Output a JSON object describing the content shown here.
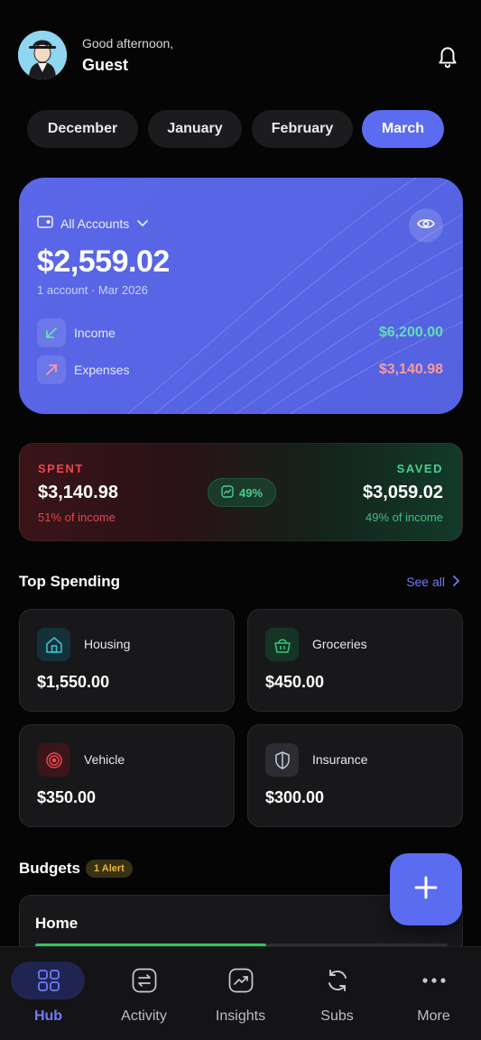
{
  "header": {
    "greeting": "Good afternoon,",
    "name": "Guest"
  },
  "months": [
    {
      "label": "December",
      "active": false
    },
    {
      "label": "January",
      "active": false
    },
    {
      "label": "February",
      "active": false
    },
    {
      "label": "March",
      "active": true
    }
  ],
  "balance": {
    "accounts_label": "All Accounts",
    "amount": "$2,559.02",
    "subtitle": "1 account · Mar 2026",
    "income_label": "Income",
    "income_value": "$6,200.00",
    "expenses_label": "Expenses",
    "expenses_value": "$3,140.98"
  },
  "summary": {
    "spent_label": "SPENT",
    "spent_amount": "$3,140.98",
    "spent_sub": "51% of income",
    "badge": "49%",
    "saved_label": "SAVED",
    "saved_amount": "$3,059.02",
    "saved_sub": "49% of income"
  },
  "top_spending": {
    "title": "Top Spending",
    "see_all": "See all",
    "items": [
      {
        "name": "Housing",
        "amount": "$1,550.00",
        "icon": "house-icon"
      },
      {
        "name": "Groceries",
        "amount": "$450.00",
        "icon": "basket-icon"
      },
      {
        "name": "Vehicle",
        "amount": "$350.00",
        "icon": "wheel-icon"
      },
      {
        "name": "Insurance",
        "amount": "$300.00",
        "icon": "shield-icon"
      }
    ]
  },
  "budgets": {
    "title": "Budgets",
    "alert": "1 Alert",
    "items": [
      {
        "name": "Home",
        "progress": 0.56
      }
    ]
  },
  "nav": [
    {
      "label": "Hub",
      "icon": "grid-icon",
      "active": true
    },
    {
      "label": "Activity",
      "icon": "transfer-icon",
      "active": false
    },
    {
      "label": "Insights",
      "icon": "trend-icon",
      "active": false
    },
    {
      "label": "Subs",
      "icon": "refresh-icon",
      "active": false
    },
    {
      "label": "More",
      "icon": "more-icon",
      "active": false
    }
  ],
  "colors": {
    "accent": "#5b6cf0",
    "income": "#5fe0b0",
    "expense": "#ff9a9a",
    "spent": "#f0464f",
    "saved": "#45d28c"
  }
}
